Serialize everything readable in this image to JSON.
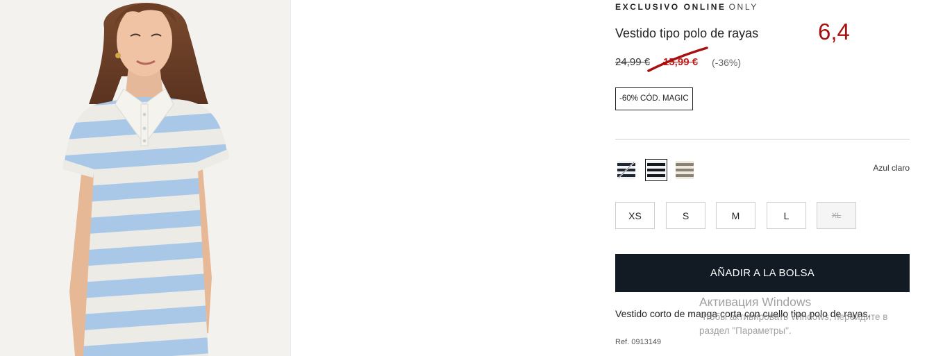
{
  "product": {
    "badge_exclusive": "EXCLUSIVO ONLINE",
    "brand": "ONLY",
    "title": "Vestido tipo polo de rayas",
    "old_price": "24,99 €",
    "sale_price": "15,99 €",
    "discount": "(-36%)",
    "promo_tag": "-60% CÓD. MAGIC",
    "selected_color_name": "Azul claro",
    "add_to_bag_label": "AÑADIR A LA BOLSA",
    "description": "Vestido corto de manga corta con cuello tipo polo de rayas.",
    "reference": "Ref. 0913149"
  },
  "annotation": {
    "handwritten_number": "6,4",
    "color": "#a80f0f"
  },
  "swatches": [
    {
      "name": "Azul marino rayas",
      "icon": "stripe-swatch-navy",
      "selected": false,
      "unavailable": true
    },
    {
      "name": "Negro rayas",
      "icon": "stripe-swatch-black",
      "selected": true,
      "unavailable": false
    },
    {
      "name": "Beige rayas",
      "icon": "stripe-swatch-khaki",
      "selected": false,
      "unavailable": false
    }
  ],
  "sizes": [
    {
      "label": "XS",
      "available": true
    },
    {
      "label": "S",
      "available": true
    },
    {
      "label": "M",
      "available": true
    },
    {
      "label": "L",
      "available": true
    },
    {
      "label": "XL",
      "available": false
    }
  ],
  "watermark": {
    "title": "Активация Windows",
    "line1": "Чтобы активировать Windows, перейдите в",
    "line2": "раздел \"Параметры\"."
  },
  "colors": {
    "accent_sale": "#c11d1d",
    "button_bg": "#121b24",
    "stripe_blue": "#a9c8e8"
  }
}
